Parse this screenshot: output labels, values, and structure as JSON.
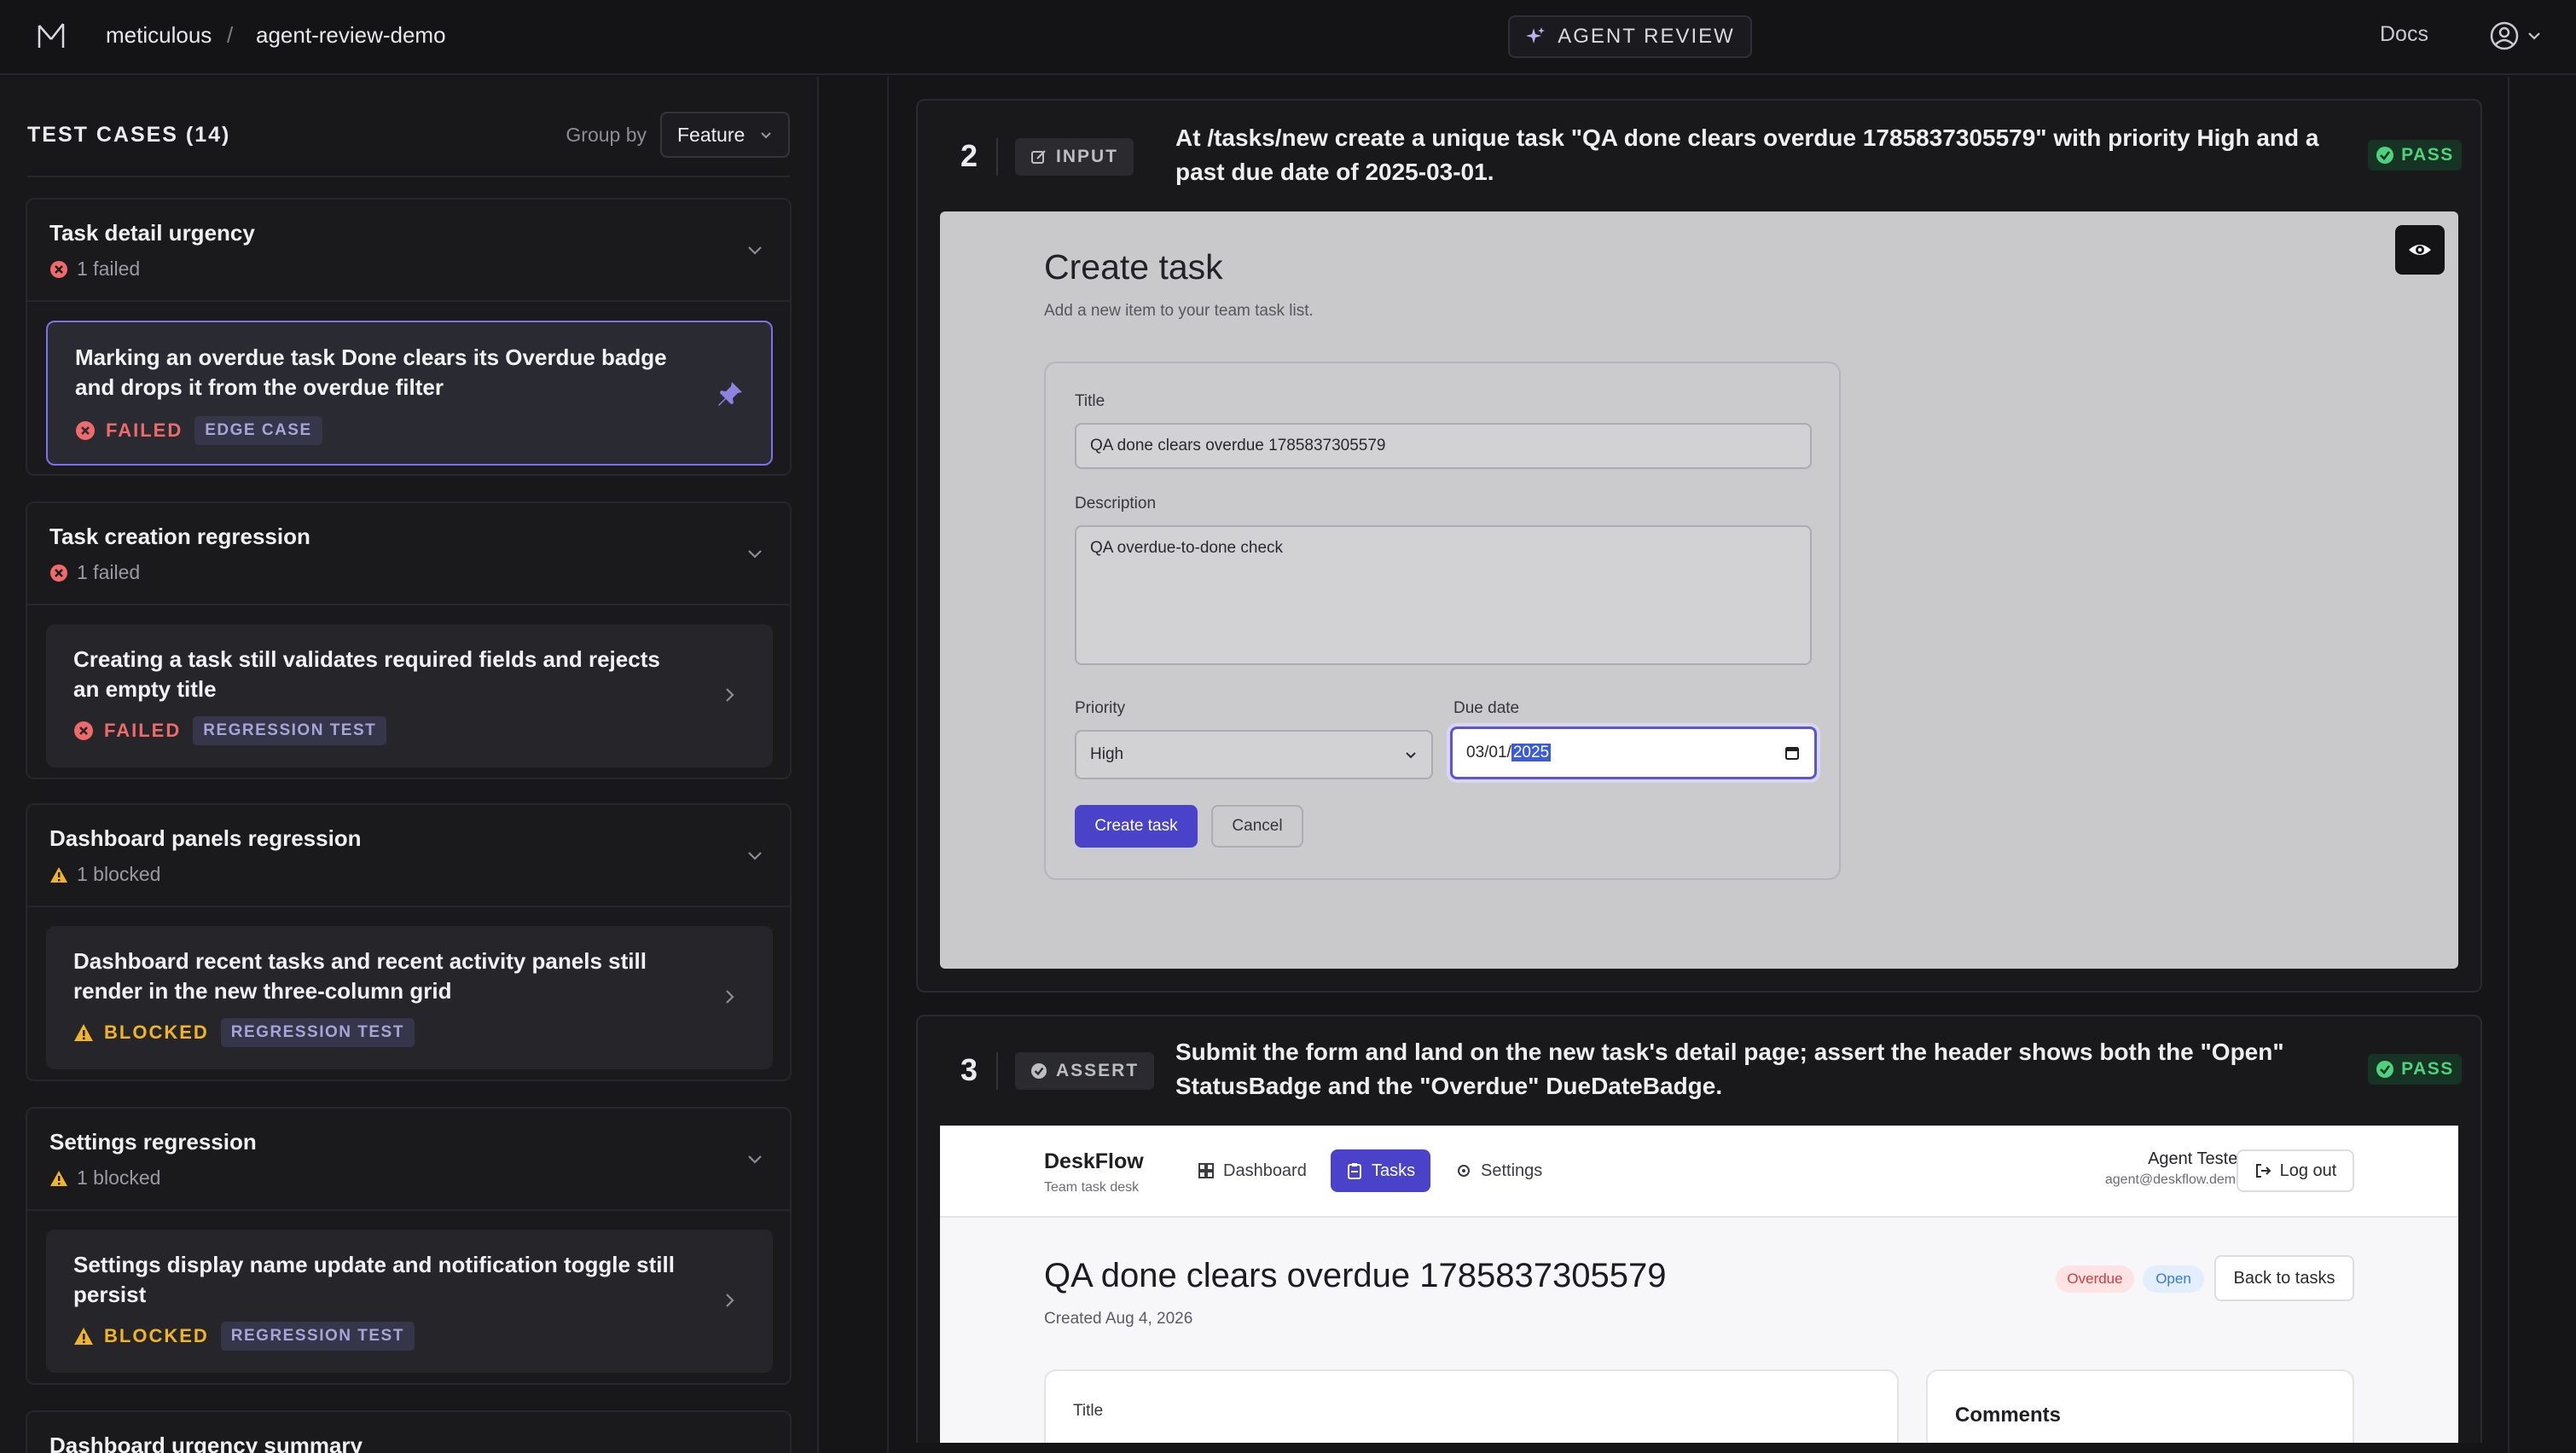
{
  "topbar": {
    "org": "meticulous",
    "separator": "/",
    "project": "agent-review-demo",
    "center_badge": "AGENT REVIEW",
    "docs": "Docs"
  },
  "sidebar": {
    "title": "TEST CASES (14)",
    "group_by_label": "Group by",
    "group_by_value": "Feature",
    "groups": [
      {
        "name": "Task detail urgency",
        "status": "1 failed",
        "case": {
          "title": "Marking an overdue task Done clears its Overdue badge and drops it from the overdue filter",
          "status": "FAILED",
          "tag": "EDGE CASE"
        }
      },
      {
        "name": "Task creation regression",
        "status": "1 failed",
        "case": {
          "title": "Creating a task still validates required fields and rejects an empty title",
          "status": "FAILED",
          "tag": "REGRESSION TEST"
        }
      },
      {
        "name": "Dashboard panels regression",
        "status": "1 blocked",
        "case": {
          "title": "Dashboard recent tasks and recent activity panels still render in the new three-column grid",
          "status": "BLOCKED",
          "tag": "REGRESSION TEST"
        }
      },
      {
        "name": "Settings regression",
        "status": "1 blocked",
        "case": {
          "title": "Settings display name update and notification toggle still persist",
          "status": "BLOCKED",
          "tag": "REGRESSION TEST"
        }
      },
      {
        "name": "Dashboard urgency summary"
      }
    ]
  },
  "steps": [
    {
      "number": "2",
      "kind": "INPUT",
      "description": "At /tasks/new create a unique task \"QA done clears overdue 1785837305579\" with priority High and a past due date of 2025-03-01.",
      "result": "PASS",
      "screenshot": {
        "title": "Create task",
        "subtitle": "Add a new item to your team task list.",
        "title_label": "Title",
        "title_value": "QA done clears overdue 1785837305579",
        "description_label": "Description",
        "description_value": "QA overdue-to-done check",
        "priority_label": "Priority",
        "priority_value": "High",
        "due_label": "Due date",
        "due_prefix": "03/01/",
        "due_year": "2025",
        "create_button": "Create task",
        "cancel_button": "Cancel"
      }
    },
    {
      "number": "3",
      "kind": "ASSERT",
      "description": "Submit the form and land on the new task's detail page; assert the header shows both the \"Open\" StatusBadge and the \"Overdue\" DueDateBadge.",
      "result": "PASS",
      "screenshot": {
        "brand": "DeskFlow",
        "brand_sub": "Team task desk",
        "nav": [
          "Dashboard",
          "Tasks",
          "Settings"
        ],
        "user_name": "Agent Tester",
        "user_email": "agent@deskflow.demo",
        "logout": "Log out",
        "task_title": "QA done clears overdue 1785837305579",
        "created": "Created Aug 4, 2026",
        "badge_overdue": "Overdue",
        "badge_open": "Open",
        "back": "Back to tasks",
        "card_title_label": "Title",
        "comments": "Comments"
      }
    }
  ],
  "colors": {
    "accent": "#7e72e8",
    "failed": "#ef6b6b",
    "blocked": "#f0b429",
    "pass": "#4fd27c",
    "app_primary": "#4a43c9"
  },
  "icons": {
    "logo": "meticulous-logo",
    "agent": "sparkle-icon",
    "user": "user-circle-icon",
    "pin": "pin-icon",
    "eye": "eye-icon",
    "check": "check-circle-icon"
  }
}
